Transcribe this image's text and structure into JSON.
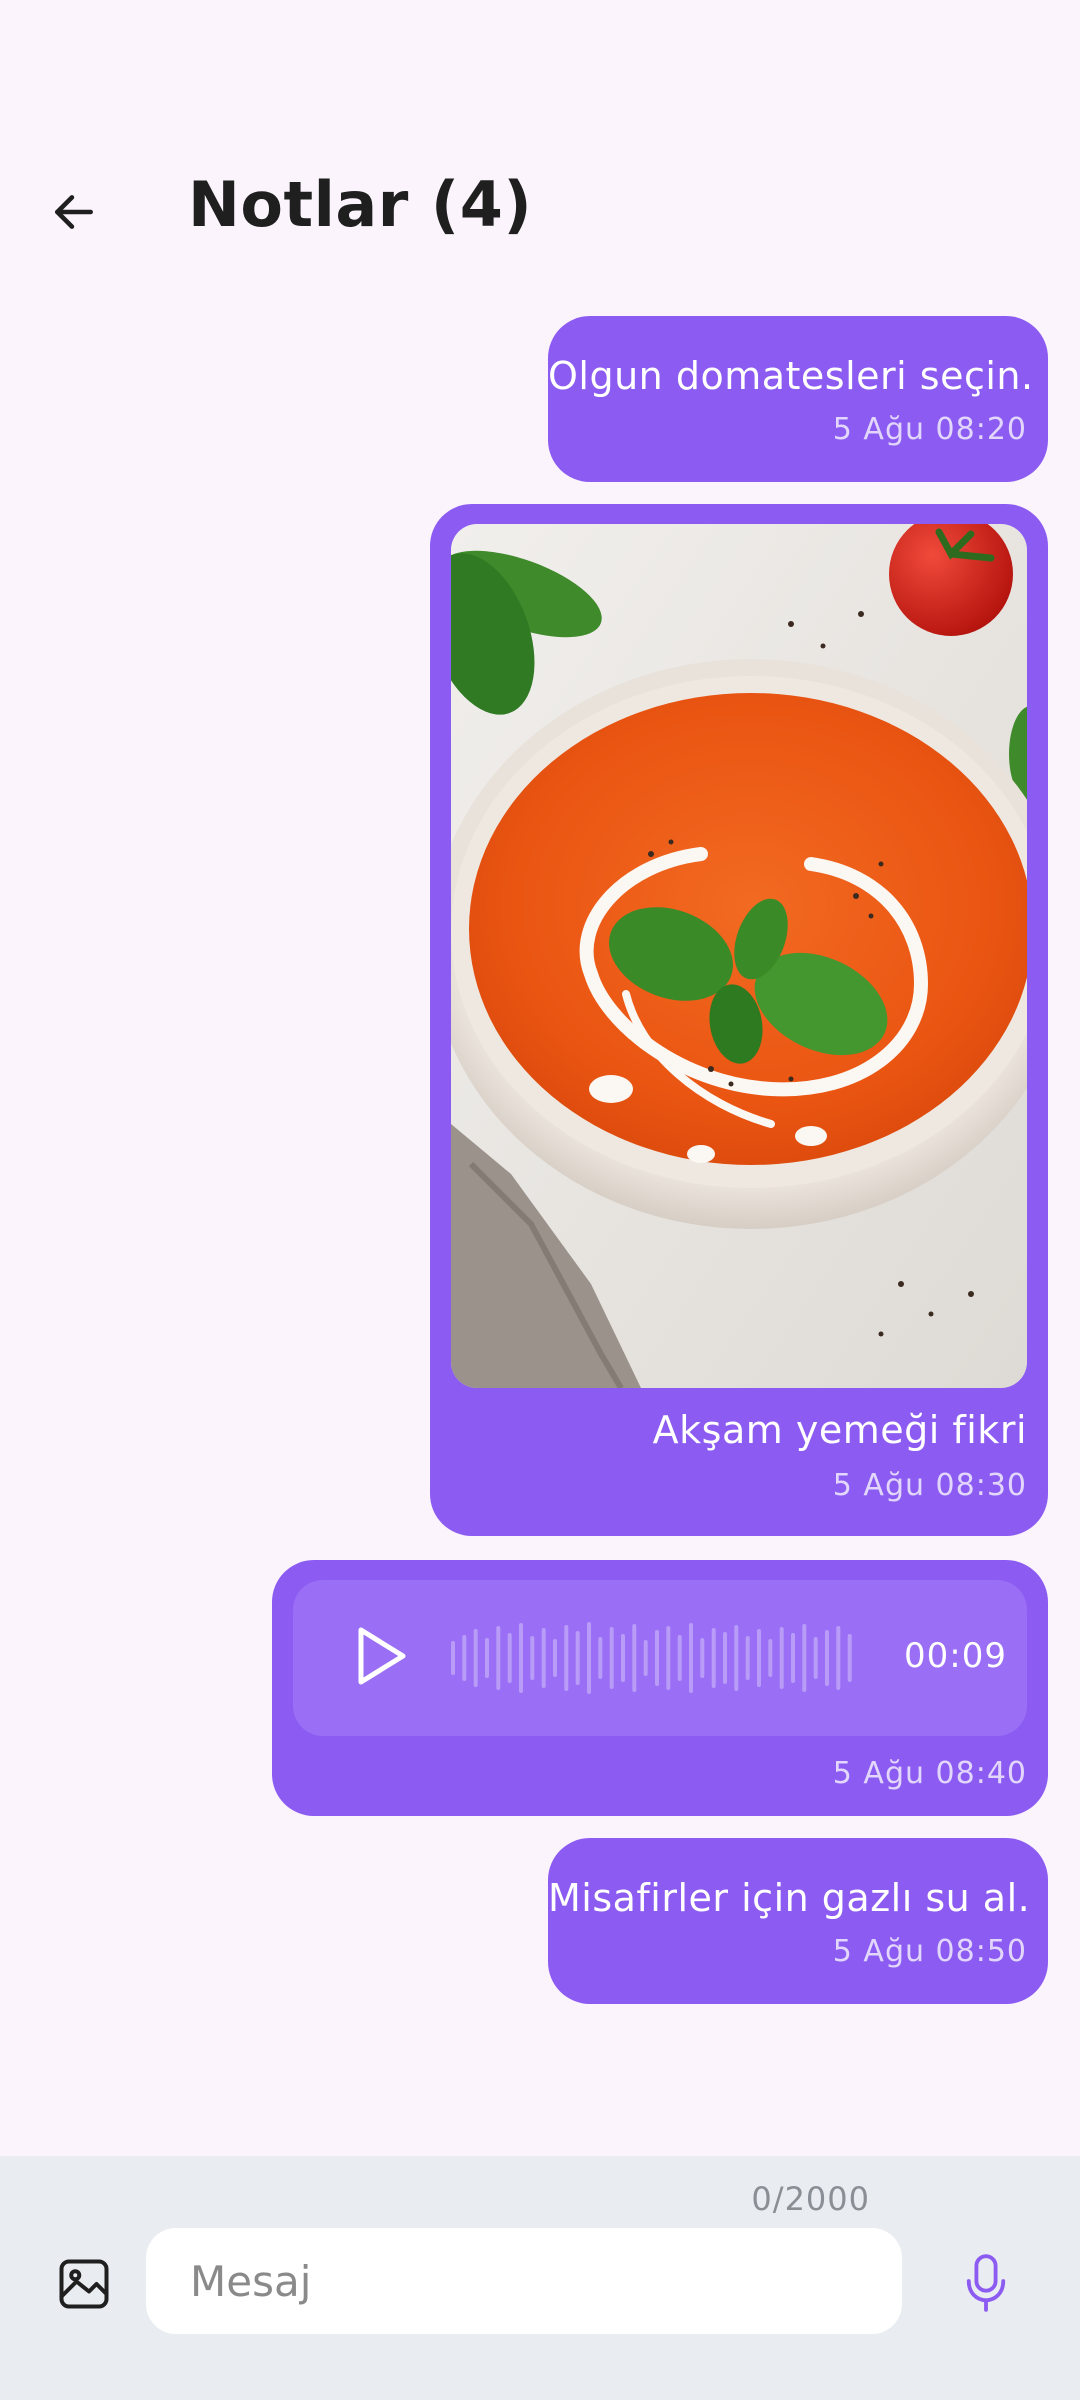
{
  "header": {
    "title": "Notlar (4)",
    "back_icon": "arrow-left-icon"
  },
  "messages": [
    {
      "type": "text",
      "text": "Olgun domatesleri seçin.",
      "time": "5 Ağu 08:20"
    },
    {
      "type": "image",
      "image": "tomato-soup-photo",
      "caption": "Akşam yemeği fikri",
      "time": "5 Ağu 08:30"
    },
    {
      "type": "audio",
      "duration": "00:09",
      "play_icon": "play-icon",
      "time": "5 Ağu 08:40"
    },
    {
      "type": "text",
      "text": "Misafirler için gazlı su al.",
      "time": "5 Ağu 08:50"
    }
  ],
  "composer": {
    "counter": "0/2000",
    "placeholder": "Mesaj",
    "gallery_icon": "image-icon",
    "mic_icon": "microphone-icon"
  },
  "colors": {
    "background": "#FBF4FC",
    "bubble": "#8C5BF2",
    "player": "#9A6EF5",
    "composer": "#E9ECF0",
    "mic": "#8C5BF2"
  }
}
